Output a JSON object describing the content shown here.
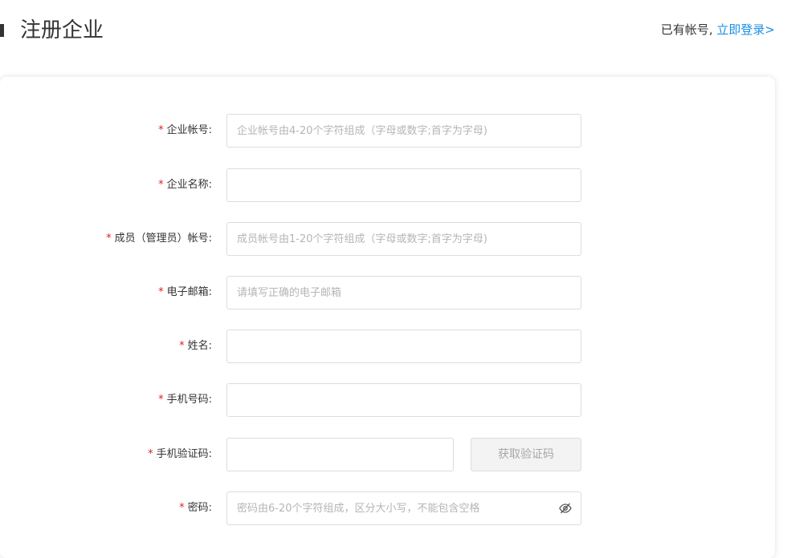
{
  "header": {
    "title": "注册企业",
    "login_prefix": "已有帐号,",
    "login_link": "立即登录>"
  },
  "form": {
    "fields": [
      {
        "label": "企业帐号:",
        "placeholder": "企业帐号由4-20个字符组成（字母或数字;首字为字母)"
      },
      {
        "label": "企业名称:",
        "placeholder": ""
      },
      {
        "label": "成员（管理员）帐号:",
        "placeholder": "成员帐号由1-20个字符组成（字母或数字;首字为字母)"
      },
      {
        "label": "电子邮箱:",
        "placeholder": "请填写正确的电子邮箱"
      },
      {
        "label": "姓名:",
        "placeholder": ""
      },
      {
        "label": "手机号码:",
        "placeholder": ""
      },
      {
        "label": "手机验证码:",
        "placeholder": ""
      },
      {
        "label": "密码:",
        "placeholder": "密码由6-20个字符组成，区分大小写，不能包含空格"
      }
    ],
    "required_mark": "*",
    "get_code_label": "获取验证码",
    "password_toggle_icon": "eye-slash-icon"
  },
  "colors": {
    "link": "#1a8fe3",
    "required": "#e02020",
    "border": "#dcdcdc",
    "placeholder": "#b5b5b5"
  }
}
